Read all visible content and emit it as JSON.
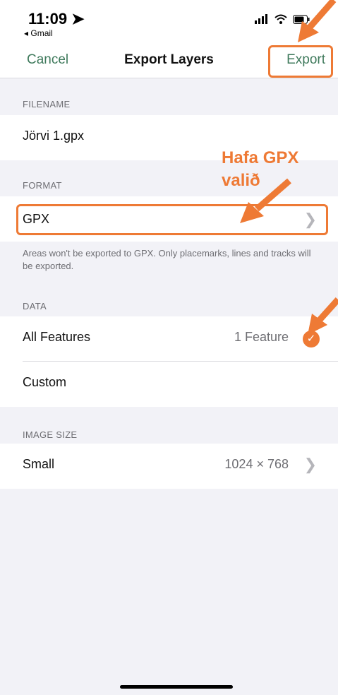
{
  "statusbar": {
    "time": "11:09",
    "back_app": "◂ Gmail"
  },
  "navbar": {
    "cancel": "Cancel",
    "title": "Export Layers",
    "export": "Export"
  },
  "filename": {
    "label": "FILENAME",
    "value": "Jörvi 1.gpx"
  },
  "format": {
    "label": "FORMAT",
    "value": "GPX",
    "hint": "Areas won't be exported to GPX. Only placemarks, lines and tracks will be exported."
  },
  "data": {
    "label": "DATA",
    "options": [
      {
        "label": "All Features",
        "detail": "1 Feature",
        "selected": true
      },
      {
        "label": "Custom"
      }
    ]
  },
  "image_size": {
    "label": "IMAGE SIZE",
    "value": "Small",
    "detail": "1024 × 768"
  },
  "annotation": {
    "line1": "Hafa GPX",
    "line2": "valið"
  },
  "colors": {
    "accent": "#3f7a5c",
    "annotation": "#ee7a35",
    "check": "#ee7a35"
  }
}
